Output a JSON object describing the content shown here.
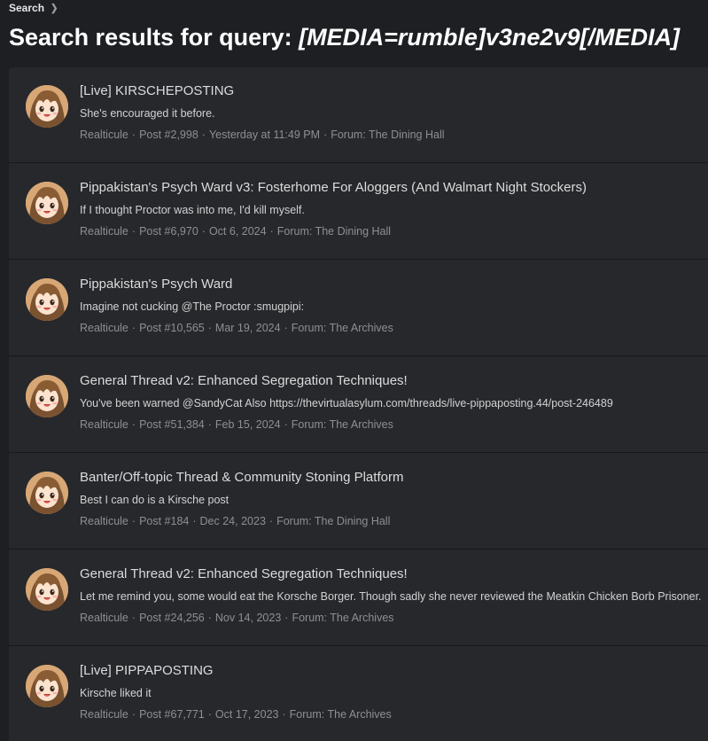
{
  "breadcrumb": {
    "label": "Search",
    "chevron_icon": "chevron-right-icon"
  },
  "page": {
    "title_prefix": "Search results for query: ",
    "query": "[MEDIA=rumble]v3ne2v9[/MEDIA]"
  },
  "colors": {
    "background": "#1d1f23",
    "panel": "#26282c",
    "title": "#ffffff",
    "meta": "#8e8f92"
  },
  "results": [
    {
      "title": "[Live] KIRSCHEPOSTING",
      "snippet": "She's encouraged it before.",
      "author": "Realticule",
      "post": "Post #2,998",
      "date": "Yesterday at 11:49 PM",
      "forum": "Forum: The Dining Hall"
    },
    {
      "title": "Pippakistan's Psych Ward v3: Fosterhome For Aloggers (And Walmart Night Stockers)",
      "snippet": "If I thought Proctor was into me, I'd kill myself.",
      "author": "Realticule",
      "post": "Post #6,970",
      "date": "Oct 6, 2024",
      "forum": "Forum: The Dining Hall"
    },
    {
      "title": "Pippakistan's Psych Ward",
      "snippet": "Imagine not cucking @The Proctor :smugpipi:",
      "author": "Realticule",
      "post": "Post #10,565",
      "date": "Mar 19, 2024",
      "forum": "Forum: The Archives"
    },
    {
      "title": "General Thread v2: Enhanced Segregation Techniques!",
      "snippet": "You've been warned @SandyCat Also https://thevirtualasylum.com/threads/live-pippaposting.44/post-246489",
      "author": "Realticule",
      "post": "Post #51,384",
      "date": "Feb 15, 2024",
      "forum": "Forum: The Archives"
    },
    {
      "title": "Banter/Off-topic Thread & Community Stoning Platform",
      "snippet": "Best I can do is a Kirsche post",
      "author": "Realticule",
      "post": "Post #184",
      "date": "Dec 24, 2023",
      "forum": "Forum: The Dining Hall"
    },
    {
      "title": "General Thread v2: Enhanced Segregation Techniques!",
      "snippet": "Let me remind you, some would eat the Korsche Borger. Though sadly she never reviewed the Meatkin Chicken Borb Prisoner.",
      "author": "Realticule",
      "post": "Post #24,256",
      "date": "Nov 14, 2023",
      "forum": "Forum: The Archives"
    },
    {
      "title": "[Live] PIPPAPOSTING",
      "snippet": "Kirsche liked it",
      "author": "Realticule",
      "post": "Post #67,771",
      "date": "Oct 17, 2023",
      "forum": "Forum: The Archives"
    }
  ]
}
